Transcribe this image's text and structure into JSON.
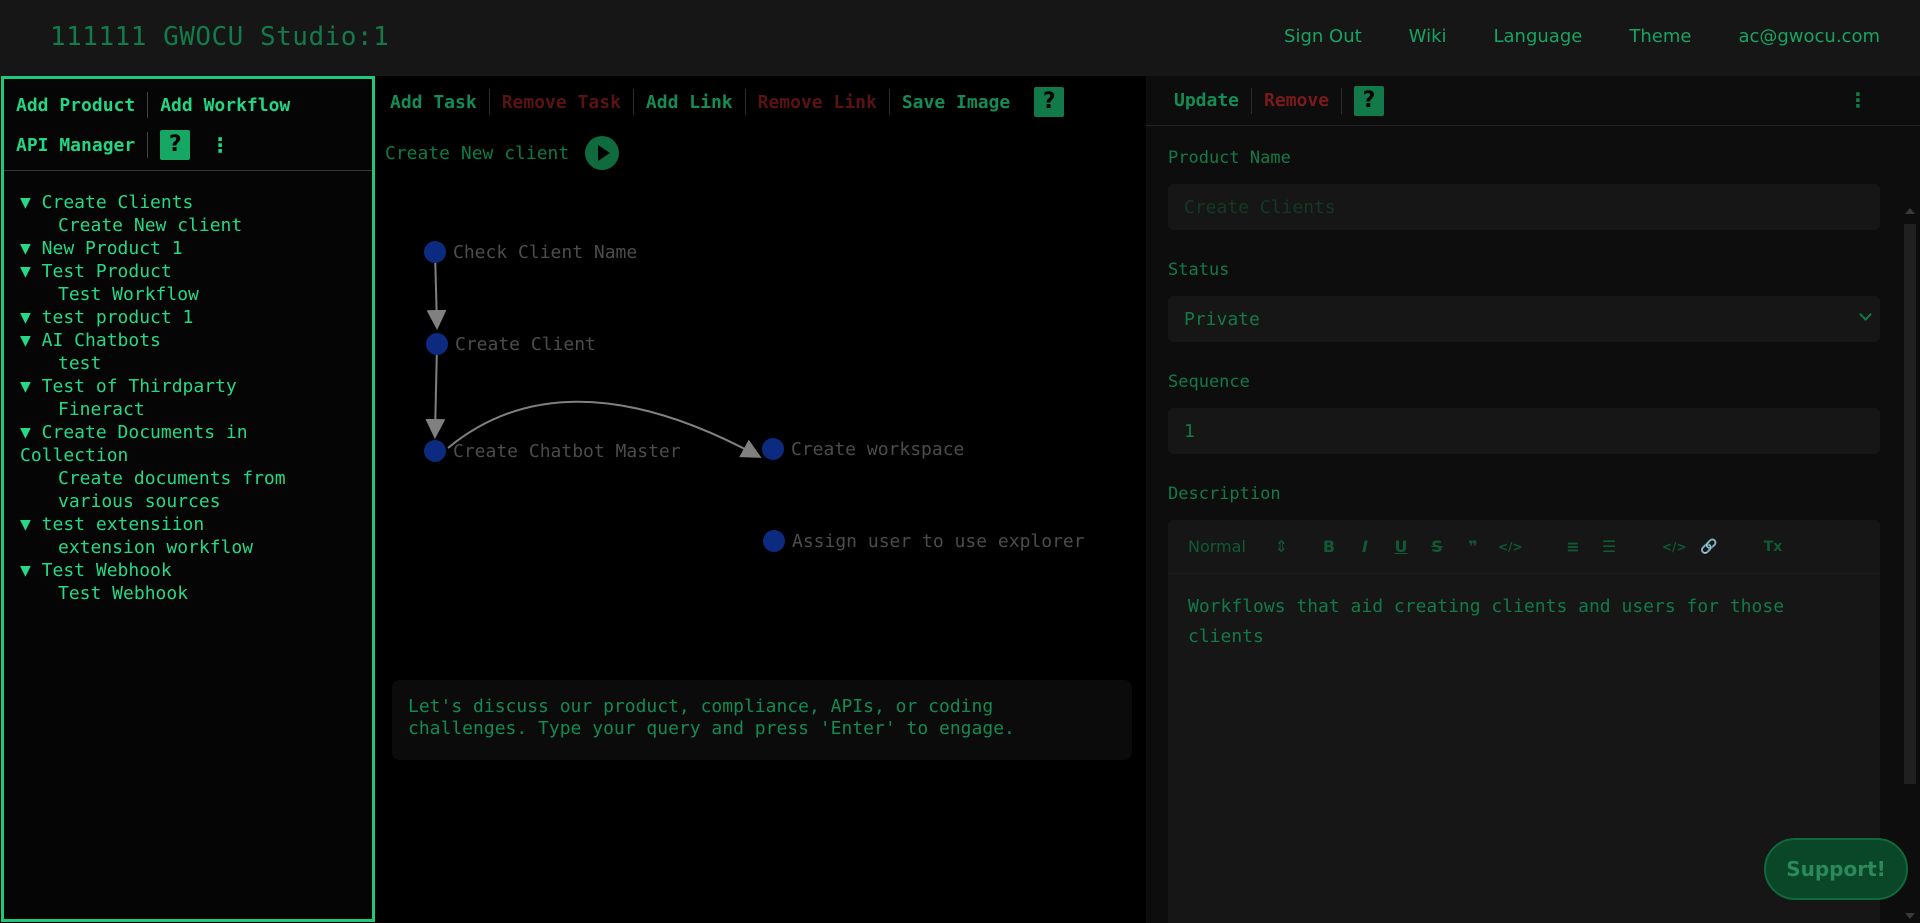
{
  "header": {
    "app_title": "111111 GWOCU Studio:1",
    "nav": [
      "Sign Out",
      "Wiki",
      "Language",
      "Theme",
      "ac@gwocu.com"
    ]
  },
  "left": {
    "add_product": "Add Product",
    "add_workflow": "Add Workflow",
    "api_manager": "API Manager",
    "help": "?",
    "more": "⋮",
    "tree": [
      {
        "label": "▼ Create Clients",
        "type": "product"
      },
      {
        "label": "Create New client",
        "type": "workflow"
      },
      {
        "label": "▼ New Product 1",
        "type": "product"
      },
      {
        "label": "▼ Test Product",
        "type": "product"
      },
      {
        "label": "Test Workflow",
        "type": "workflow"
      },
      {
        "label": "▼ test product 1",
        "type": "product"
      },
      {
        "label": "▼ AI Chatbots",
        "type": "product"
      },
      {
        "label": "test",
        "type": "workflow"
      },
      {
        "label": "▼ Test of Thirdparty",
        "type": "product"
      },
      {
        "label": "Fineract",
        "type": "workflow"
      },
      {
        "label": "▼ Create Documents in Collection",
        "type": "product"
      },
      {
        "label": "Create documents from various sources",
        "type": "workflow"
      },
      {
        "label": "▼ test extensiion",
        "type": "product"
      },
      {
        "label": "extension workflow",
        "type": "workflow"
      },
      {
        "label": "▼ Test Webhook",
        "type": "product"
      },
      {
        "label": "Test Webhook",
        "type": "workflow"
      }
    ]
  },
  "middle": {
    "toolbar": {
      "add_task": "Add Task",
      "remove_task": "Remove Task",
      "add_link": "Add Link",
      "remove_link": "Remove Link",
      "save_image": "Save Image",
      "help": "?"
    },
    "workflow_name": "Create New client",
    "nodes": [
      "Check Client Name",
      "Create Client",
      "Create Chatbot Master",
      "Create workspace",
      "Assign user to use explorer"
    ],
    "chat_prompt": "Let's discuss our product, compliance, APIs, or coding challenges. Type your query and press 'Enter' to engage."
  },
  "right": {
    "update": "Update",
    "remove": "Remove",
    "help": "?",
    "more": "⋮",
    "product_name_label": "Product Name",
    "product_name_placeholder": "Create Clients",
    "status_label": "Status",
    "status_value": "Private",
    "sequence_label": "Sequence",
    "sequence_value": "1",
    "description_label": "Description",
    "editor_format": "Normal",
    "editor_format_arrow": "⇕",
    "editor_tools": [
      "B",
      "I",
      "U",
      "S",
      "❞",
      "</>",
      "≡",
      "☰",
      "</>",
      "🔗",
      "Tx"
    ],
    "description": "Workflows that aid creating clients and users for those clients"
  },
  "support": "Support!",
  "colors": {
    "accent": "#21c77a",
    "danger": "#5a1313",
    "node": "#0c2a80"
  }
}
